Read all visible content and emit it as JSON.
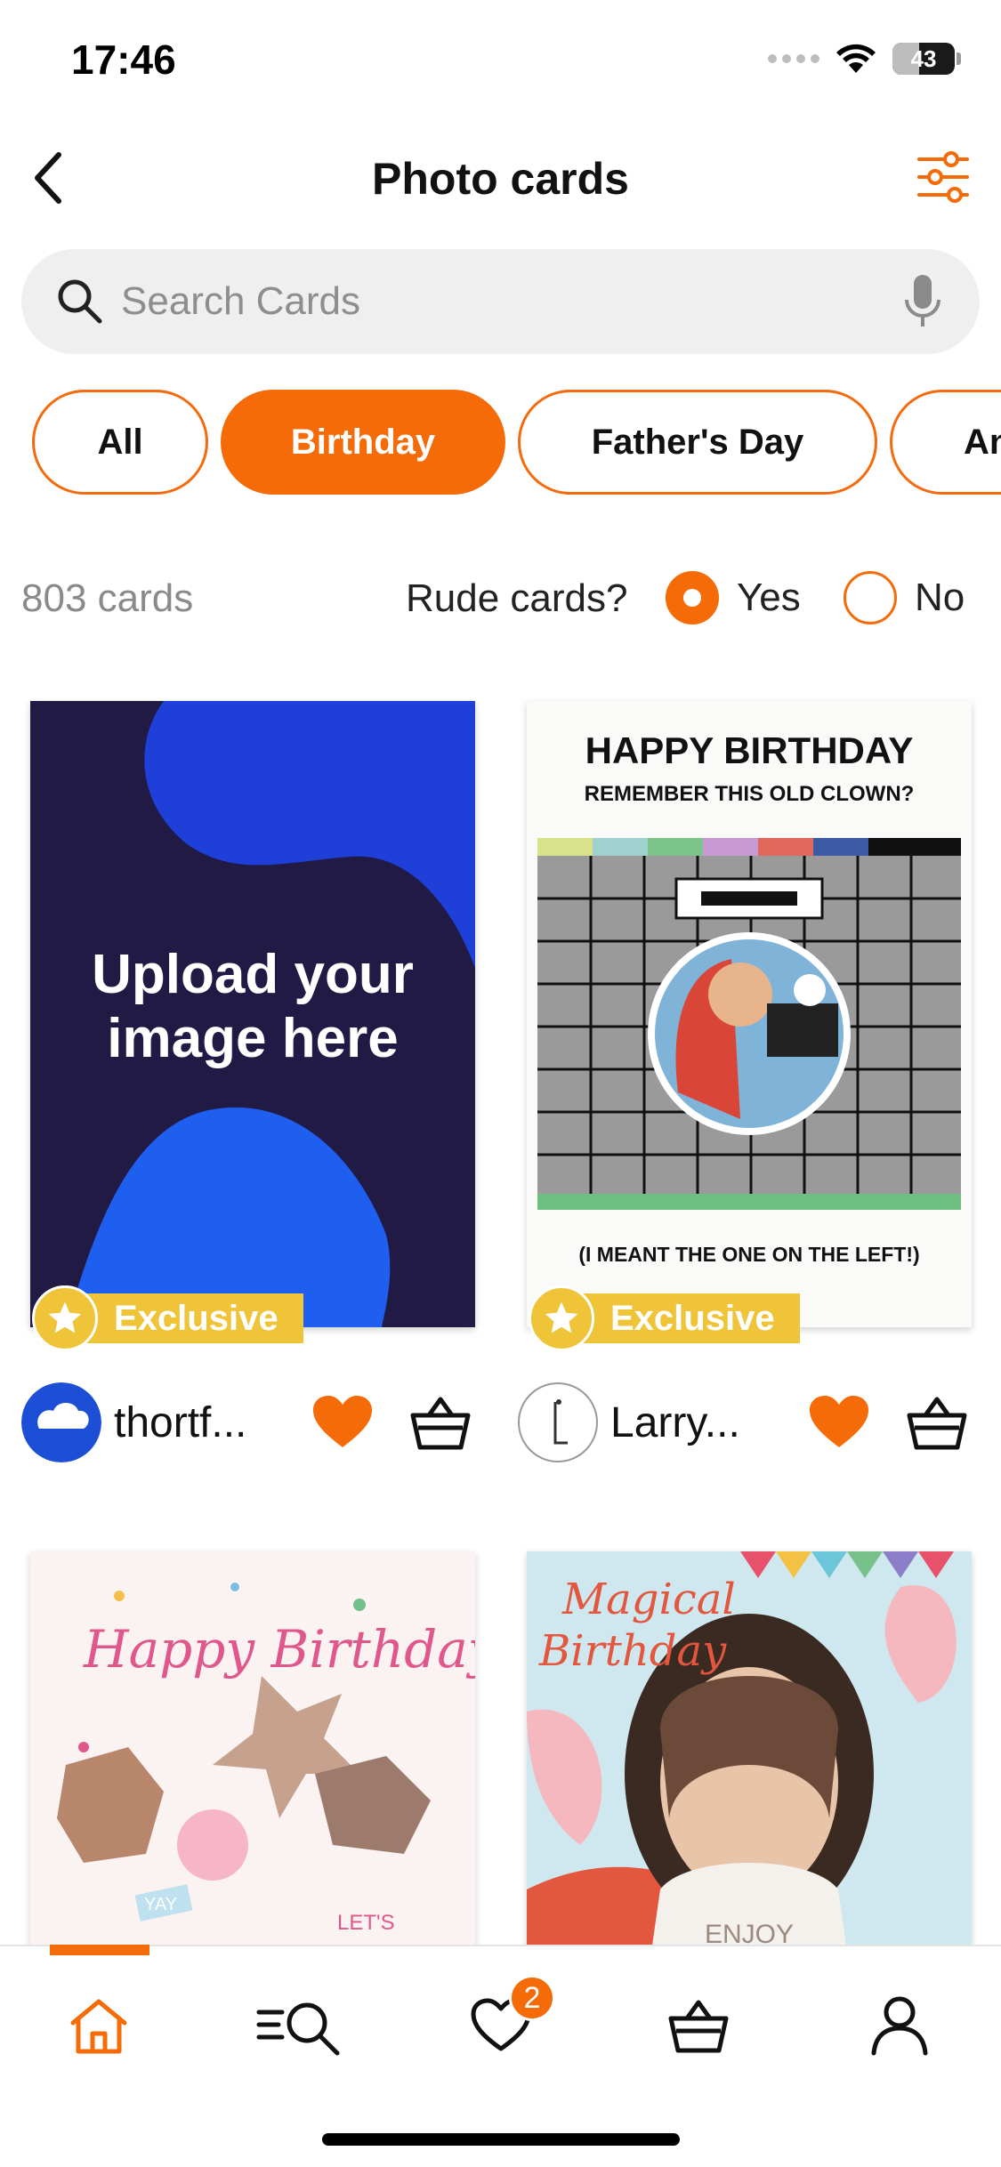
{
  "status_bar": {
    "time": "17:46",
    "battery": "43",
    "battery_level": 0.43
  },
  "header": {
    "title": "Photo cards"
  },
  "search": {
    "placeholder": "Search Cards"
  },
  "categories": [
    {
      "label": "All",
      "active": false
    },
    {
      "label": "Birthday",
      "active": true
    },
    {
      "label": "Father's Day",
      "active": false
    },
    {
      "label": "An",
      "active": false
    }
  ],
  "filters": {
    "count": "803 cards",
    "rude_label": "Rude cards?",
    "yes_label": "Yes",
    "no_label": "No",
    "selected": "Yes"
  },
  "cards": [
    {
      "image_text": [
        "Upload your",
        "image here"
      ],
      "badge": "Exclusive",
      "author": "thortf...",
      "favourited": true
    },
    {
      "image_text": [
        "HAPPY BIRTHDAY",
        "REMEMBER THIS OLD CLOWN?",
        "(I MEANT THE ONE ON THE LEFT!)"
      ],
      "badge": "Exclusive",
      "author": "Larry...",
      "favourited": true
    },
    {
      "image_text": [
        "Happy Birthday",
        "YAY",
        "LET'S"
      ],
      "badge": "",
      "author": "",
      "favourited": false
    },
    {
      "image_text": [
        "Magical",
        "Birthday",
        "ENJOY"
      ],
      "badge": "",
      "author": "",
      "favourited": false
    }
  ],
  "nav": {
    "items": [
      "home-icon",
      "browse-search-icon",
      "heart-icon",
      "basket-icon",
      "account-icon"
    ],
    "favourites_count": "2",
    "active": "home"
  },
  "colors": {
    "accent": "#f46b08",
    "badge": "#f0c438",
    "upload_bg": "#211a45",
    "upload_blob": "#1e5ff0"
  }
}
